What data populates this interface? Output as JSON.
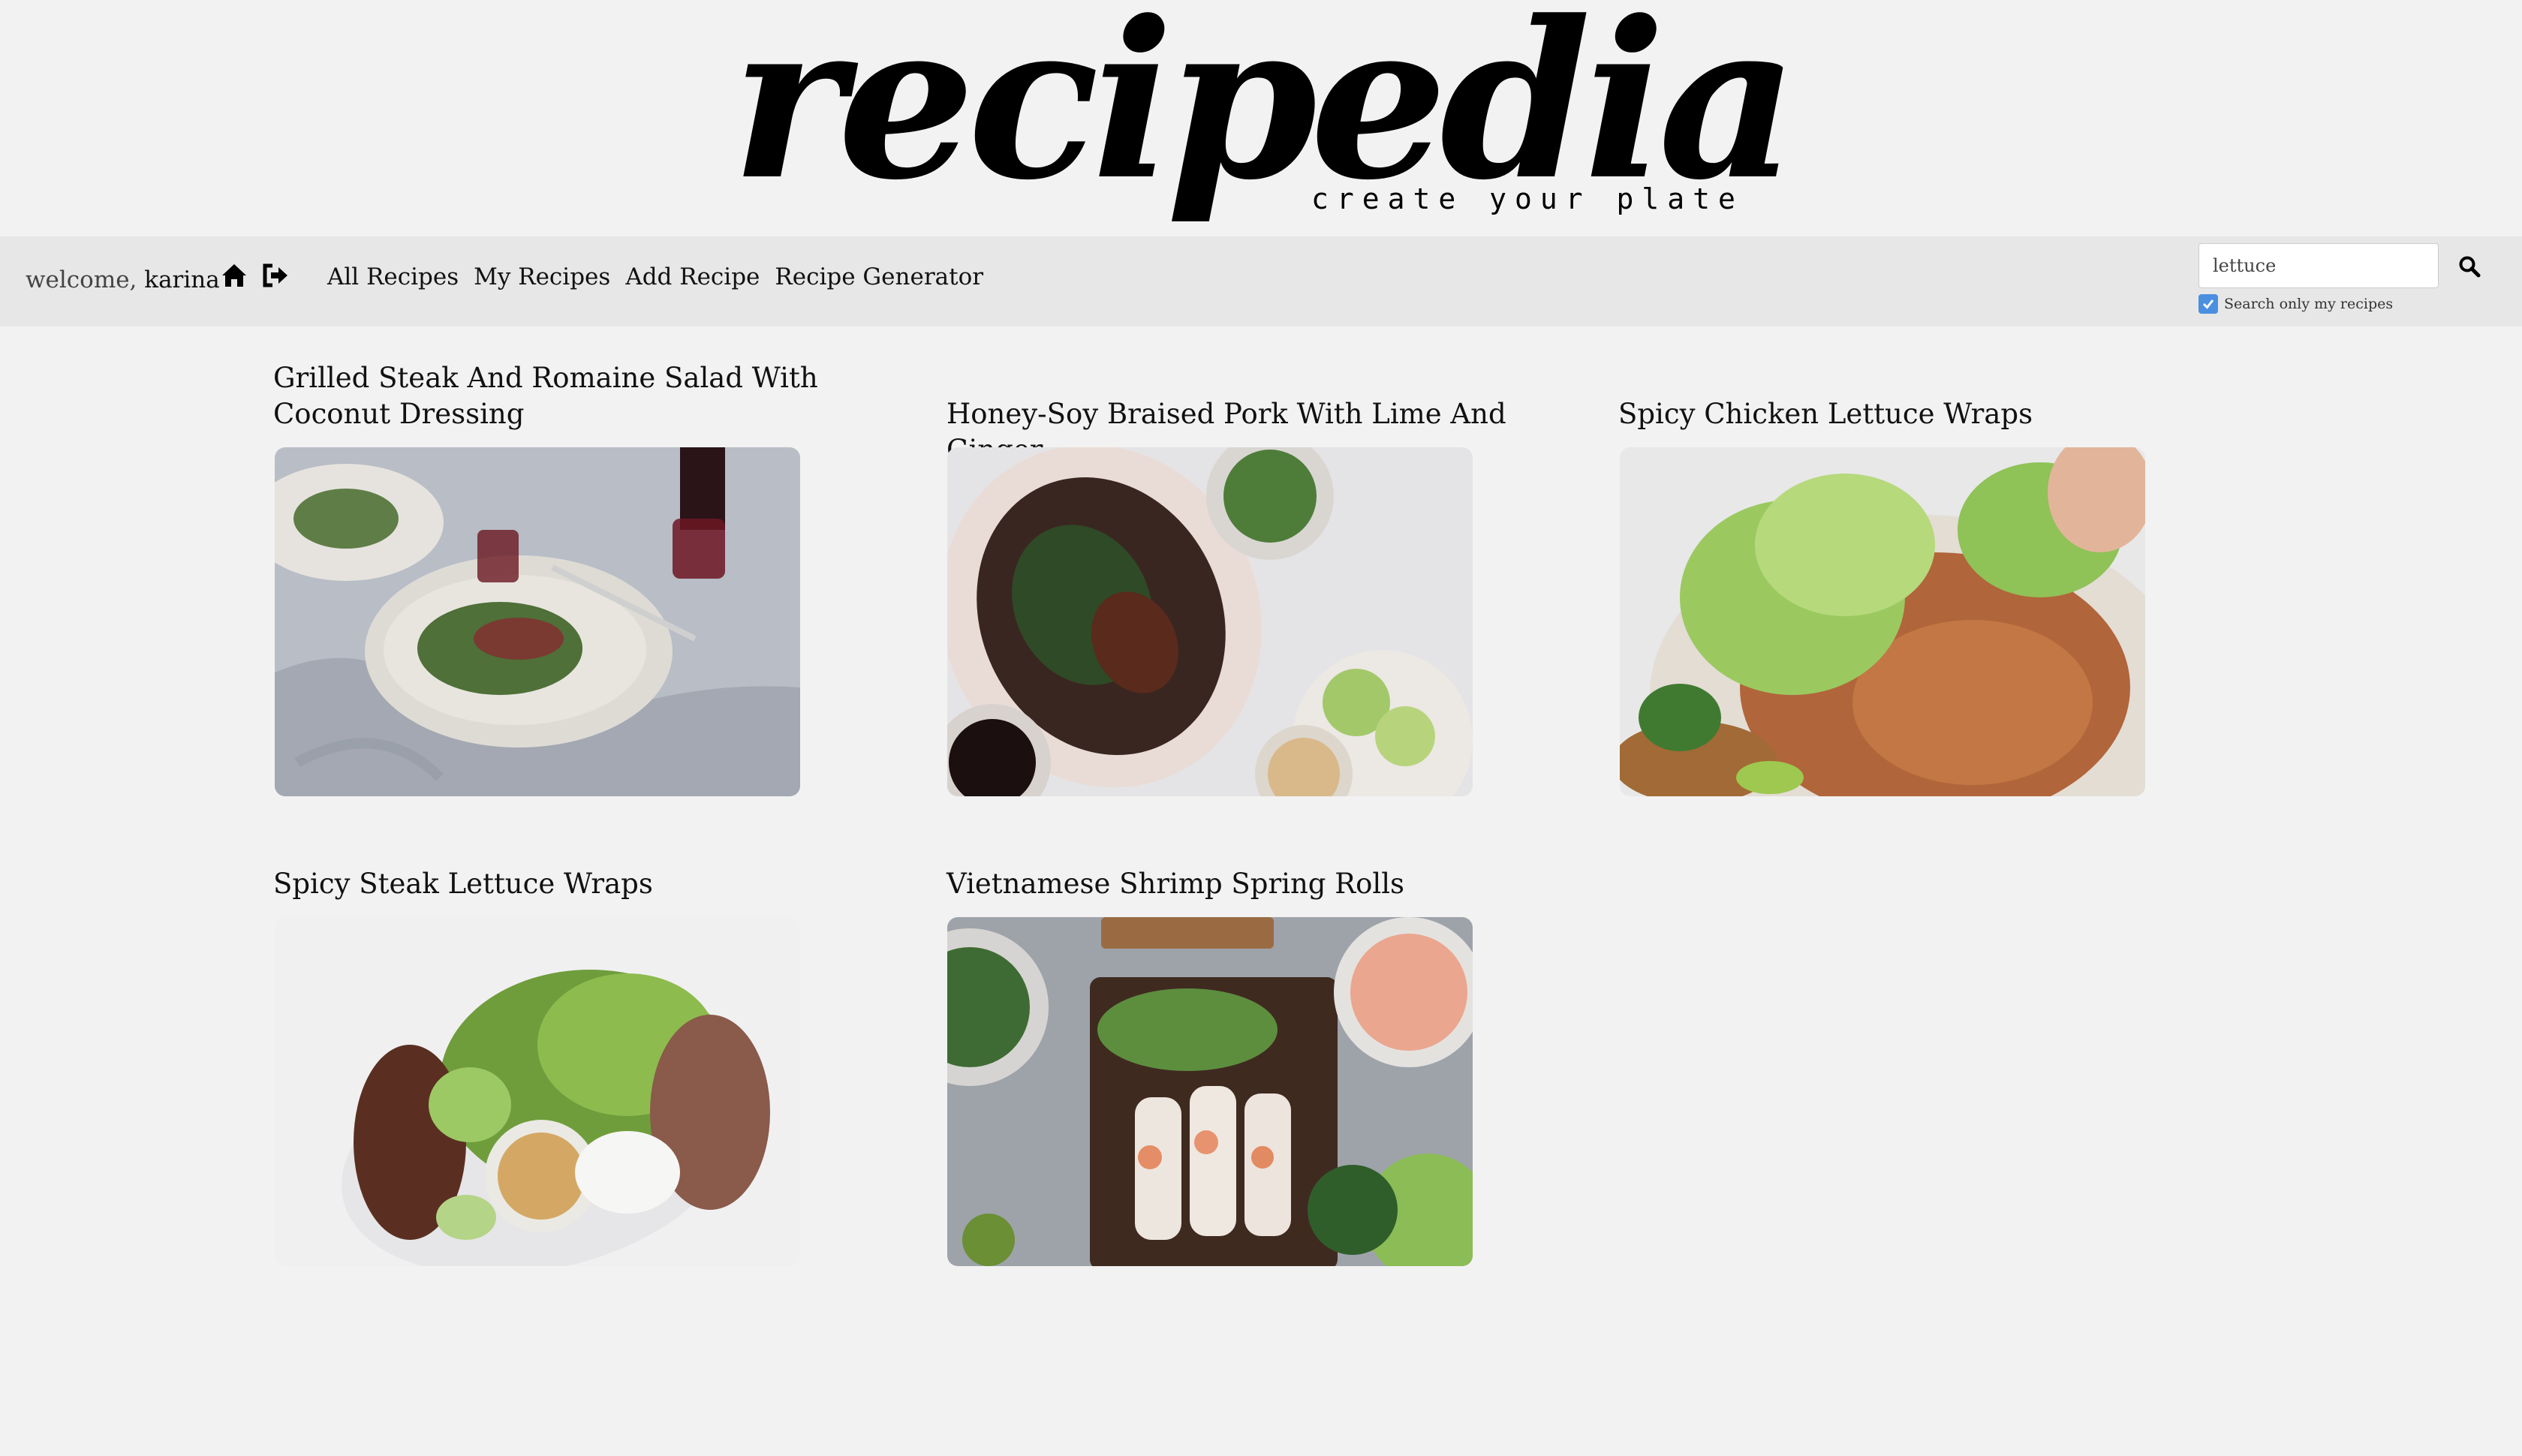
{
  "header": {
    "logo": "recipedia",
    "tagline": "create your plate"
  },
  "nav": {
    "welcome_prefix": "welcome,",
    "username": "karina",
    "home_icon": "home-icon",
    "logout_icon": "sign-out-icon",
    "links": [
      "All Recipes",
      "My Recipes",
      "Add Recipe",
      "Recipe Generator"
    ]
  },
  "search": {
    "value": "lettuce",
    "checkbox_label": "Search only my recipes",
    "checkbox_checked": true,
    "icon": "search-icon"
  },
  "recipes": [
    {
      "title": "Grilled Steak And Romaine Salad With Coconut Dressing"
    },
    {
      "title": "Honey-Soy Braised Pork With Lime And Ginger"
    },
    {
      "title": "Spicy Chicken Lettuce Wraps"
    },
    {
      "title": "Spicy Steak Lettuce Wraps"
    },
    {
      "title": "Vietnamese Shrimp Spring Rolls"
    }
  ]
}
